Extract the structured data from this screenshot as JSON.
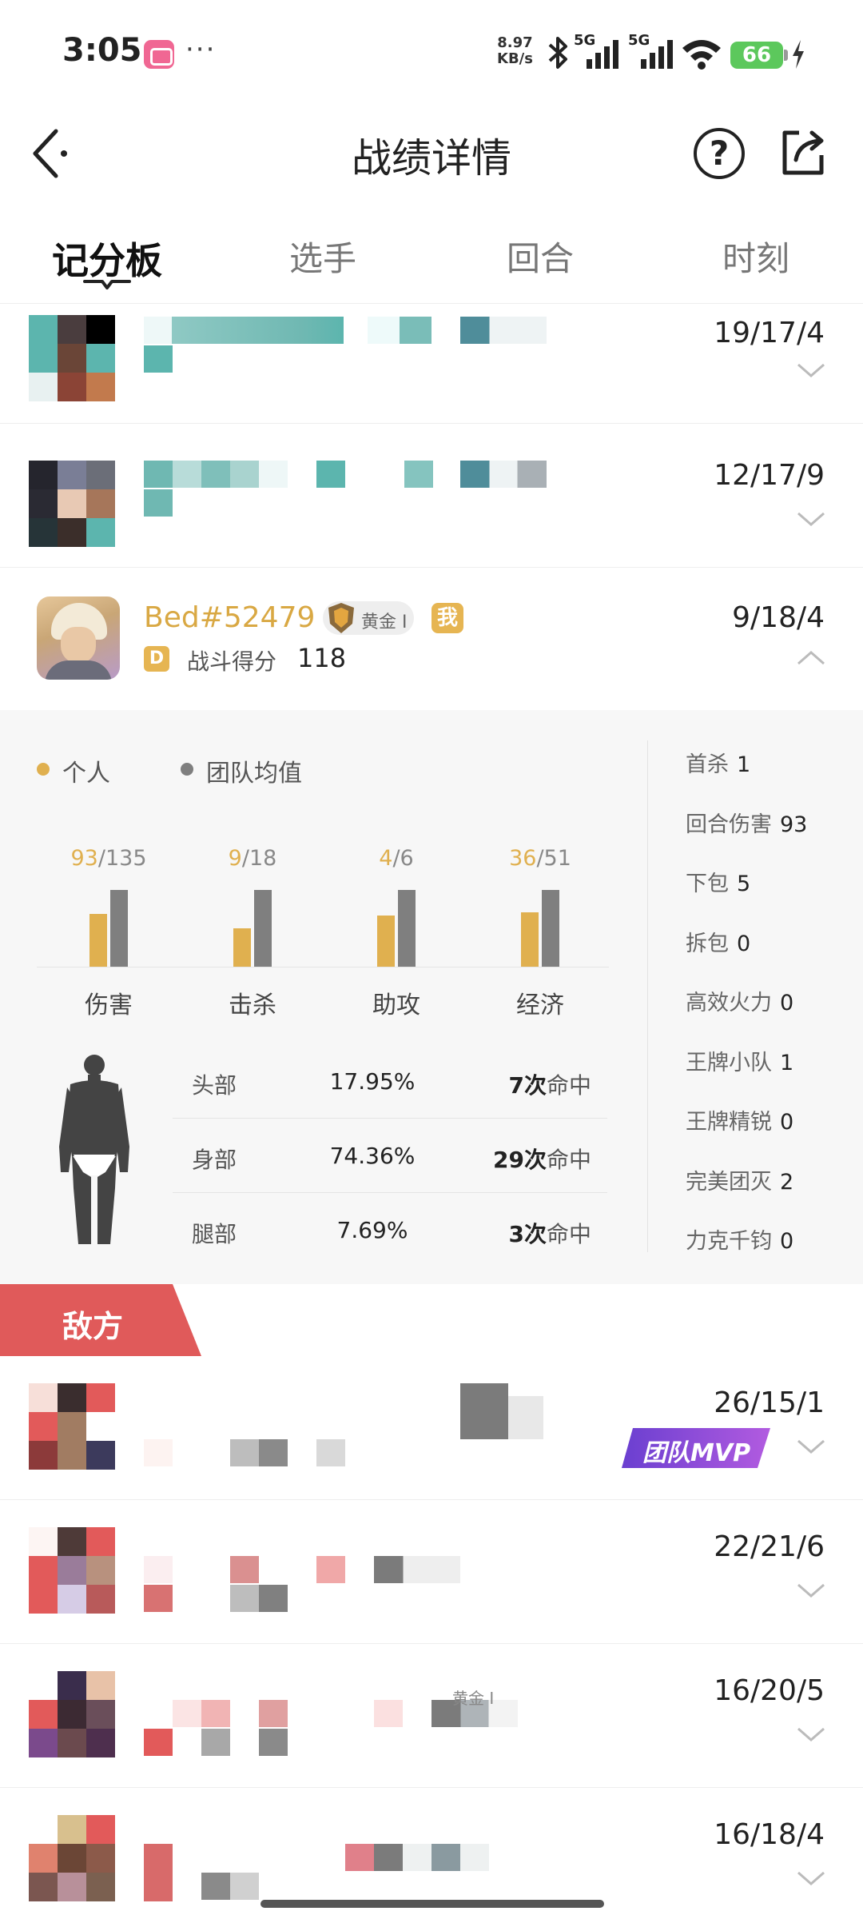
{
  "status_bar": {
    "time": "3:05",
    "dots": "···",
    "net_speed_value": "8.97",
    "net_speed_unit": "KB/s",
    "sim1": "5G",
    "sim2": "5G",
    "battery": "66"
  },
  "header": {
    "title": "战绩详情",
    "help_label": "?"
  },
  "tabs": [
    {
      "label": "记分板",
      "active": true
    },
    {
      "label": "选手",
      "active": false
    },
    {
      "label": "回合",
      "active": false
    },
    {
      "label": "时刻",
      "active": false
    }
  ],
  "team_rows": [
    {
      "kda": "19/17/4"
    },
    {
      "kda": "12/17/9"
    }
  ],
  "self": {
    "name": "Bed#52479",
    "rank": "黄金 I",
    "me_badge": "我",
    "grade": "D",
    "score_label": "战斗得分",
    "score": "118",
    "kda": "9/18/4"
  },
  "detail": {
    "legend": {
      "personal": "个人",
      "team_avg": "团队均值"
    },
    "legend_colors": {
      "personal": "#e0b04f",
      "team_avg": "#7f7f7f"
    },
    "chart_data": {
      "type": "bar",
      "categories": [
        "伤害",
        "击杀",
        "助攻",
        "经济"
      ],
      "series": [
        {
          "name": "个人",
          "values": [
            93,
            9,
            4,
            36
          ]
        },
        {
          "name": "团队均值",
          "values": [
            135,
            18,
            6,
            51
          ]
        }
      ]
    },
    "stats": [
      {
        "label": "首杀",
        "value": "1"
      },
      {
        "label": "回合伤害",
        "value": "93"
      },
      {
        "label": "下包",
        "value": "5"
      },
      {
        "label": "拆包",
        "value": "0"
      },
      {
        "label": "高效火力",
        "value": "0"
      },
      {
        "label": "王牌小队",
        "value": "1"
      },
      {
        "label": "王牌精锐",
        "value": "0"
      },
      {
        "label": "完美团灭",
        "value": "2"
      },
      {
        "label": "力克千钧",
        "value": "0"
      }
    ],
    "hits": [
      {
        "part": "头部",
        "pct": "17.95%",
        "count": "7次",
        "suffix": "命中"
      },
      {
        "part": "身部",
        "pct": "74.36%",
        "count": "29次",
        "suffix": "命中"
      },
      {
        "part": "腿部",
        "pct": "7.69%",
        "count": "3次",
        "suffix": "命中"
      }
    ]
  },
  "enemy": {
    "label": "敌方",
    "mvp_label": "团队MVP",
    "rank_fragment": "黄金 I",
    "rows": [
      {
        "kda": "26/15/1"
      },
      {
        "kda": "22/21/6"
      },
      {
        "kda": "16/20/5"
      },
      {
        "kda": "16/18/4"
      }
    ]
  }
}
